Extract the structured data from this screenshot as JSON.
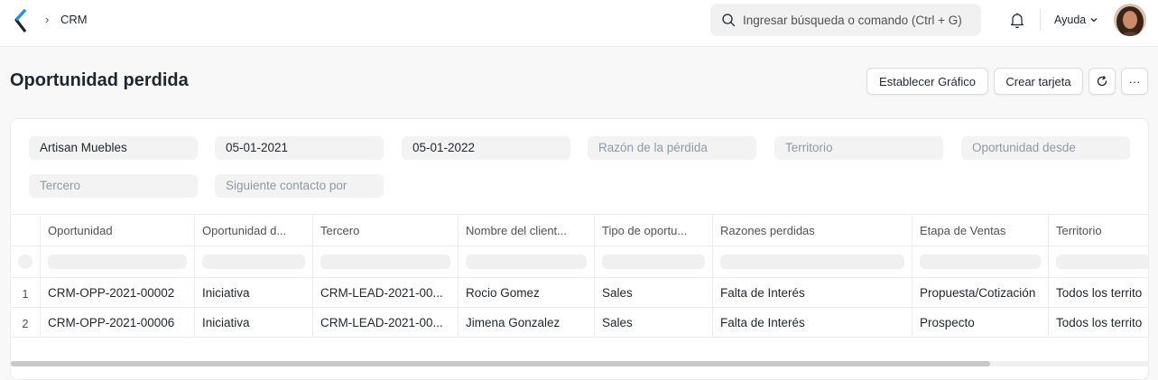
{
  "navbar": {
    "breadcrumb": "CRM",
    "search_placeholder": "Ingresar búsqueda o comando (Ctrl + G)",
    "help_label": "Ayuda"
  },
  "page": {
    "title": "Oportunidad perdida",
    "set_chart_label": "Establecer Gráfico",
    "create_card_label": "Crear tarjeta",
    "more_label": "···"
  },
  "filters": {
    "company": "Artisan Muebles",
    "from_date": "05-01-2021",
    "to_date": "05-01-2022",
    "lost_reason_placeholder": "Razón de la pérdida",
    "territory_placeholder": "Territorio",
    "opportunity_from_placeholder": "Oportunidad desde",
    "party_placeholder": "Tercero",
    "next_contact_placeholder": "Siguiente contacto por"
  },
  "table": {
    "columns": [
      "Oportunidad",
      "Oportunidad d...",
      "Tercero",
      "Nombre del client...",
      "Tipo de oportu...",
      "Razones perdidas",
      "Etapa de Ventas",
      "Territorio"
    ],
    "rows": [
      {
        "index": "1",
        "cells": [
          "CRM-OPP-2021-00002",
          "Iniciativa",
          "CRM-LEAD-2021-00...",
          "Rocio Gomez",
          "Sales",
          "Falta de Interés",
          "Propuesta/Cotización",
          "Todos los territo"
        ]
      },
      {
        "index": "2",
        "cells": [
          "CRM-OPP-2021-00006",
          "Iniciativa",
          "CRM-LEAD-2021-00...",
          "Jimena Gonzalez",
          "Sales",
          "Falta de Interés",
          "Prospecto",
          "Todos los territo"
        ]
      }
    ]
  },
  "colors": {
    "logo": "#2490ef",
    "text": "#1f272e",
    "muted": "#8d99a6",
    "control_bg": "#f3f3f3"
  }
}
